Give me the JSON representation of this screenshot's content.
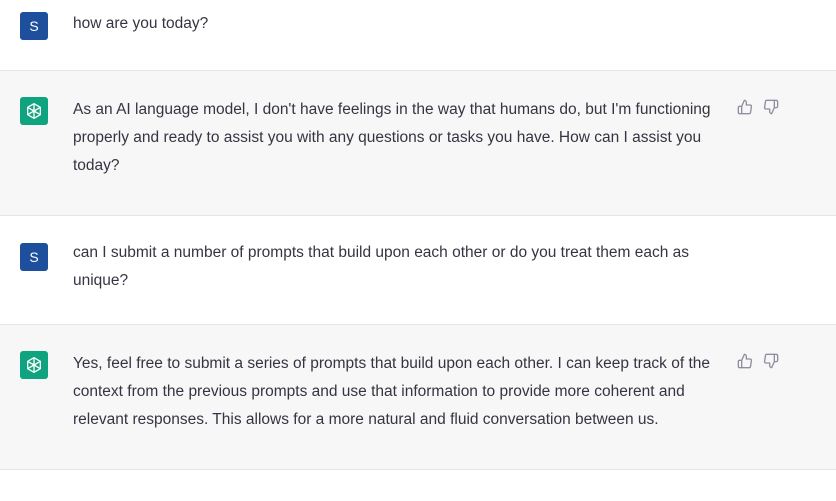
{
  "messages": [
    {
      "role": "user",
      "avatar_label": "S",
      "text": "how are you today?"
    },
    {
      "role": "assistant",
      "avatar_icon": "openai-logo-icon",
      "text": "As an AI language model, I don't have feelings in the way that humans do, but I'm functioning properly and ready to assist you with any questions or tasks you have. How can I assist you today?"
    },
    {
      "role": "user",
      "avatar_label": "S",
      "text": "can I submit a number of prompts that build upon each other or do you treat them each as unique?"
    },
    {
      "role": "assistant",
      "avatar_icon": "openai-logo-icon",
      "text": "Yes, feel free to submit a series of prompts that build upon each other. I can keep track of the context from the previous prompts and use that information to provide more coherent and relevant responses. This allows for a more natural and fluid conversation between us."
    }
  ],
  "feedback_icons": [
    "thumbs-up-icon",
    "thumbs-down-icon"
  ],
  "colors": {
    "user_avatar": "#1e4f9c",
    "assistant_avatar": "#10a37f",
    "assistant_bg": "#f7f7f8"
  }
}
